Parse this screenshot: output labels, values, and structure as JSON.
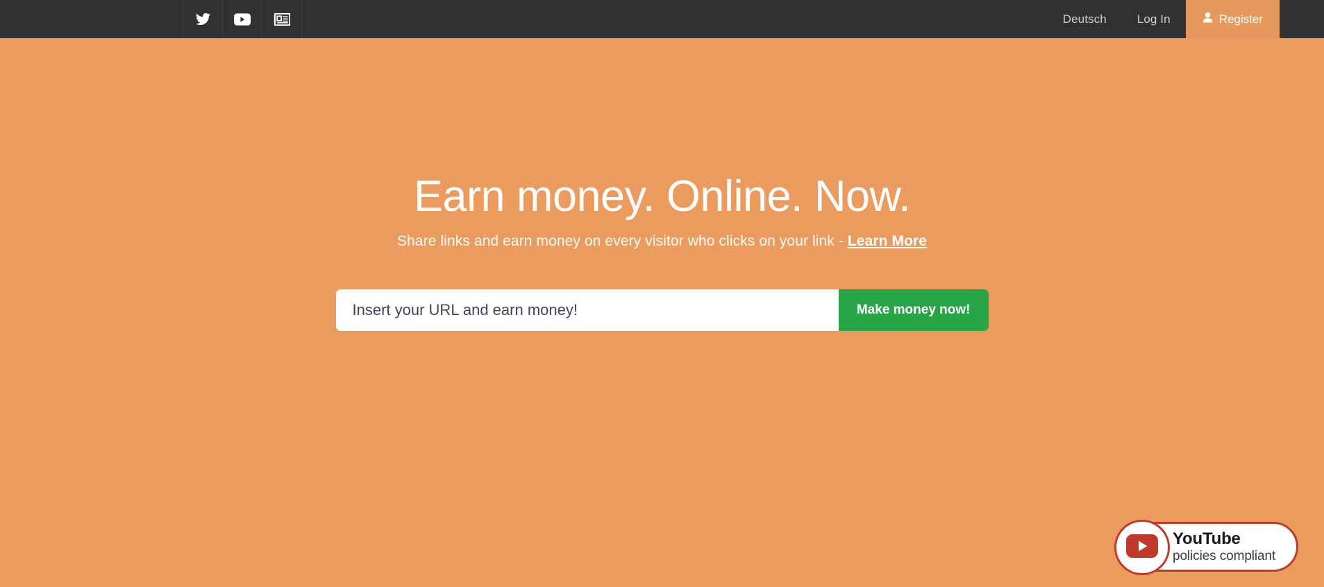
{
  "navbar": {
    "social_icons": [
      {
        "name": "twitter-icon",
        "label": "Twitter"
      },
      {
        "name": "youtube-icon",
        "label": "YouTube"
      },
      {
        "name": "newspaper-icon",
        "label": "News"
      }
    ],
    "language_label": "Deutsch",
    "login_label": "Log In",
    "register_label": "Register",
    "background_color": "#313131",
    "link_color": "#cfcfcf"
  },
  "hero": {
    "title": "Earn money. Online. Now.",
    "subtitle_prefix": "Share links and earn money on every visitor who clicks on your link - ",
    "subtitle_link": "Learn More",
    "background_color": "#ec9b5f"
  },
  "url_form": {
    "placeholder": "Insert your URL and earn money!",
    "value": "",
    "submit_label": "Make money now!",
    "submit_color": "#28a546"
  },
  "youtube_badge": {
    "title": "YouTube",
    "subtitle": "policies compliant",
    "icon_name": "youtube-play-icon",
    "accent_color": "#c0392b"
  }
}
